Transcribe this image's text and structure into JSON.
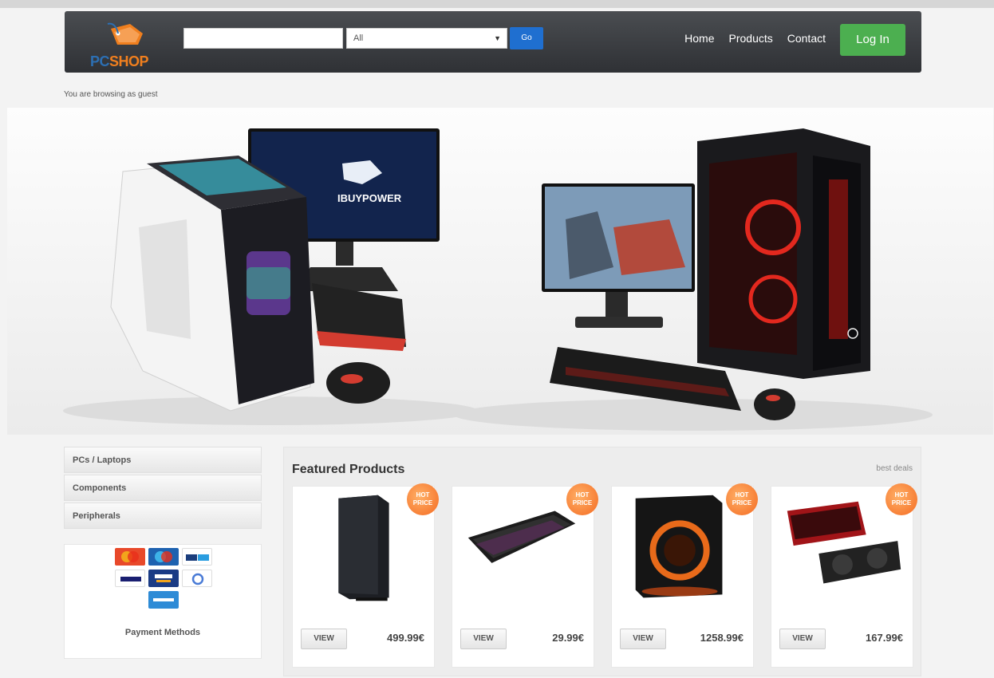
{
  "brand": {
    "logo_pc": "PC",
    "logo_shop": "SHOP"
  },
  "search": {
    "placeholder": "",
    "category_selected": "All",
    "go_label": "Go"
  },
  "nav": {
    "items": [
      "Home",
      "Products",
      "Contact"
    ],
    "login_label": "Log In"
  },
  "guest_text": "You are browsing as guest",
  "hero": {
    "monitor_brand": "IBUYPOWER"
  },
  "sidebar": {
    "items": [
      "PCs / Laptops",
      "Components",
      "Peripherals"
    ]
  },
  "payment": {
    "label": "Payment Methods",
    "cards": [
      "MasterCard",
      "Maestro",
      "PayPal",
      "VISA",
      "Visa Electron",
      "Google Pay",
      "American Express"
    ]
  },
  "featured": {
    "title": "Featured Products",
    "best_deals": "best deals",
    "badge": "HOT PRICE",
    "view_label": "VIEW",
    "products": [
      {
        "price": "499.99€",
        "visual": "pc-tower"
      },
      {
        "price": "29.99€",
        "visual": "keyboard"
      },
      {
        "price": "1258.99€",
        "visual": "cpu-box"
      },
      {
        "price": "167.99€",
        "visual": "graphics-card"
      }
    ]
  },
  "colors": {
    "navbar": "#3a3d41",
    "login_green": "#4caf50",
    "go_blue": "#1f6fd0",
    "badge_orange": "#f46a21"
  }
}
